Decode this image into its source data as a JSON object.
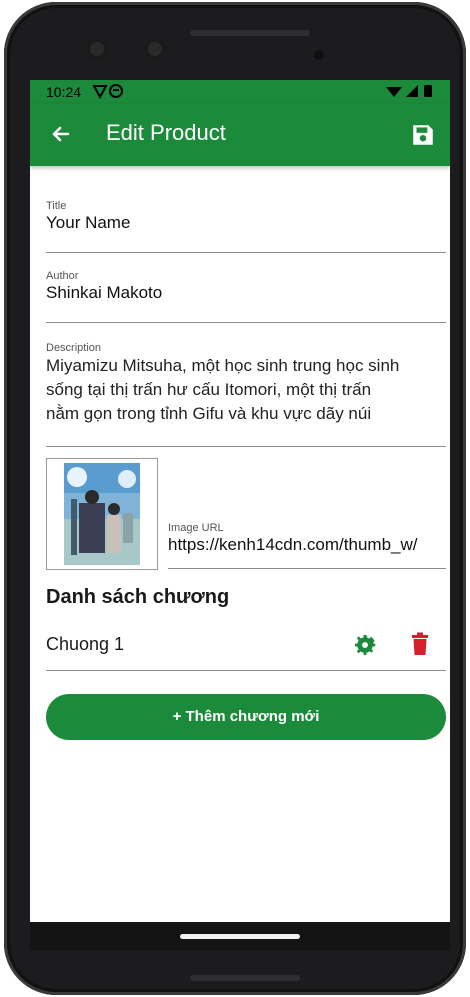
{
  "status_bar": {
    "time": "10:24"
  },
  "app_bar": {
    "title": "Edit Product"
  },
  "fields": {
    "title": {
      "label": "Title",
      "value": "Your Name"
    },
    "author": {
      "label": "Author",
      "value": "Shinkai Makoto"
    },
    "description": {
      "label": "Description",
      "line1": "Miyamizu Mitsuha, một học sinh trung học sinh",
      "line2": "sống tại thị trấn hư cấu Itomori, một thị trấn",
      "line3": "nằm gọn trong tỉnh Gifu và khu vực dãy núi"
    },
    "image_url": {
      "label": "Image URL",
      "value": "https://kenh14cdn.com/thumb_w/"
    }
  },
  "chapters": {
    "heading": "Danh sách chương",
    "items": [
      {
        "label": "Chuong 1"
      }
    ],
    "add_label": "+ Thêm chương mới"
  },
  "colors": {
    "primary": "#1b8a3b",
    "delete": "#d3212b",
    "gear": "#1b8a3b"
  },
  "icons": [
    "back-arrow-icon",
    "save-icon",
    "gear-icon",
    "trash-icon"
  ]
}
